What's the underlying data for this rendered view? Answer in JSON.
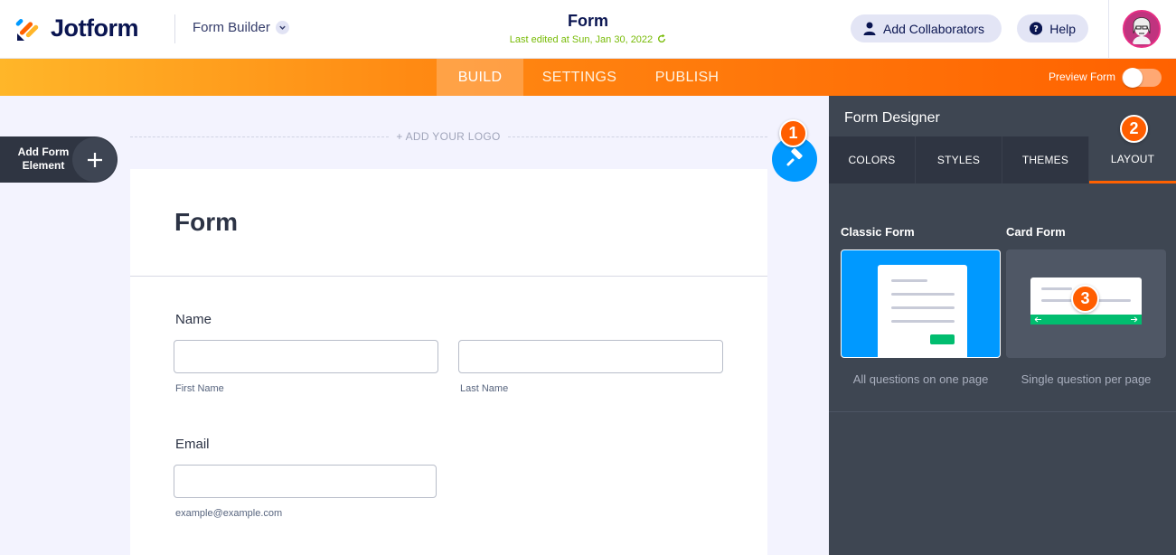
{
  "header": {
    "brand": "Jotform",
    "builder_menu": "Form Builder",
    "form_title": "Form",
    "last_edited": "Last edited at Sun, Jan 30, 2022",
    "add_collaborators": "Add Collaborators",
    "help": "Help"
  },
  "nav": {
    "build": "BUILD",
    "settings": "SETTINGS",
    "publish": "PUBLISH",
    "preview_form": "Preview Form",
    "preview_enabled": false
  },
  "sidebar": {
    "add_form_element_line1": "Add Form",
    "add_form_element_line2": "Element"
  },
  "canvas": {
    "add_logo": "+ ADD YOUR LOGO"
  },
  "form": {
    "title": "Form",
    "name_label": "Name",
    "first_name": "First Name",
    "last_name": "Last Name",
    "email_label": "Email",
    "email_sublabel": "example@example.com"
  },
  "designer": {
    "title": "Form Designer",
    "tabs": [
      "COLORS",
      "STYLES",
      "THEMES",
      "LAYOUT"
    ],
    "active_tab": "LAYOUT",
    "classic": {
      "title": "Classic Form",
      "desc": "All questions on one page"
    },
    "card": {
      "title": "Card Form",
      "desc": "Single question per page"
    }
  },
  "badges": [
    "1",
    "2",
    "3"
  ],
  "colors": {
    "accent_orange": "#ff6100",
    "accent_blue": "#0099ff",
    "panel_dark": "#3e4652",
    "green": "#78bb07"
  }
}
